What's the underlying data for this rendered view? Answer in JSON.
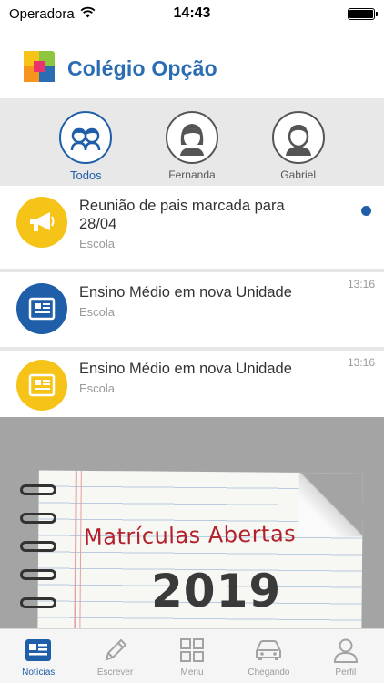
{
  "status_bar": {
    "carrier": "Operadora",
    "time": "14:43"
  },
  "app": {
    "title": "Colégio Opção"
  },
  "filters": [
    {
      "label": "Todos",
      "active": true
    },
    {
      "label": "Fernanda",
      "active": false
    },
    {
      "label": "Gabriel",
      "active": false
    }
  ],
  "news": [
    {
      "title": "Reunião de pais marcada para 28/04",
      "category": "Escola",
      "time": "",
      "unread": true,
      "icon": "megaphone-icon",
      "icon_color": "#f6c419"
    },
    {
      "title": "Ensino Médio em nova Unidade",
      "category": "Escola",
      "time": "13:16",
      "unread": false,
      "icon": "newspaper-icon",
      "icon_color": "#1f5ea8"
    },
    {
      "title": "Ensino Médio em nova Unidade",
      "category": "Escola",
      "time": "13:16",
      "unread": false,
      "icon": "newspaper-icon",
      "icon_color": "#f6c419"
    }
  ],
  "banner": {
    "headline": "Matrículas Abertas",
    "year": "2019"
  },
  "tabs": [
    {
      "label": "Notícias",
      "icon": "newspaper-icon",
      "active": true
    },
    {
      "label": "Escrever",
      "icon": "pencil-icon",
      "active": false
    },
    {
      "label": "Menu",
      "icon": "grid-icon",
      "active": false
    },
    {
      "label": "Chegando",
      "icon": "car-icon",
      "active": false
    },
    {
      "label": "Perfil",
      "icon": "person-icon",
      "active": false
    }
  ],
  "colors": {
    "brand": "#2a6db2",
    "accent": "#1f5ea8",
    "yellow": "#f6c419",
    "banner_red": "#b4202a"
  }
}
